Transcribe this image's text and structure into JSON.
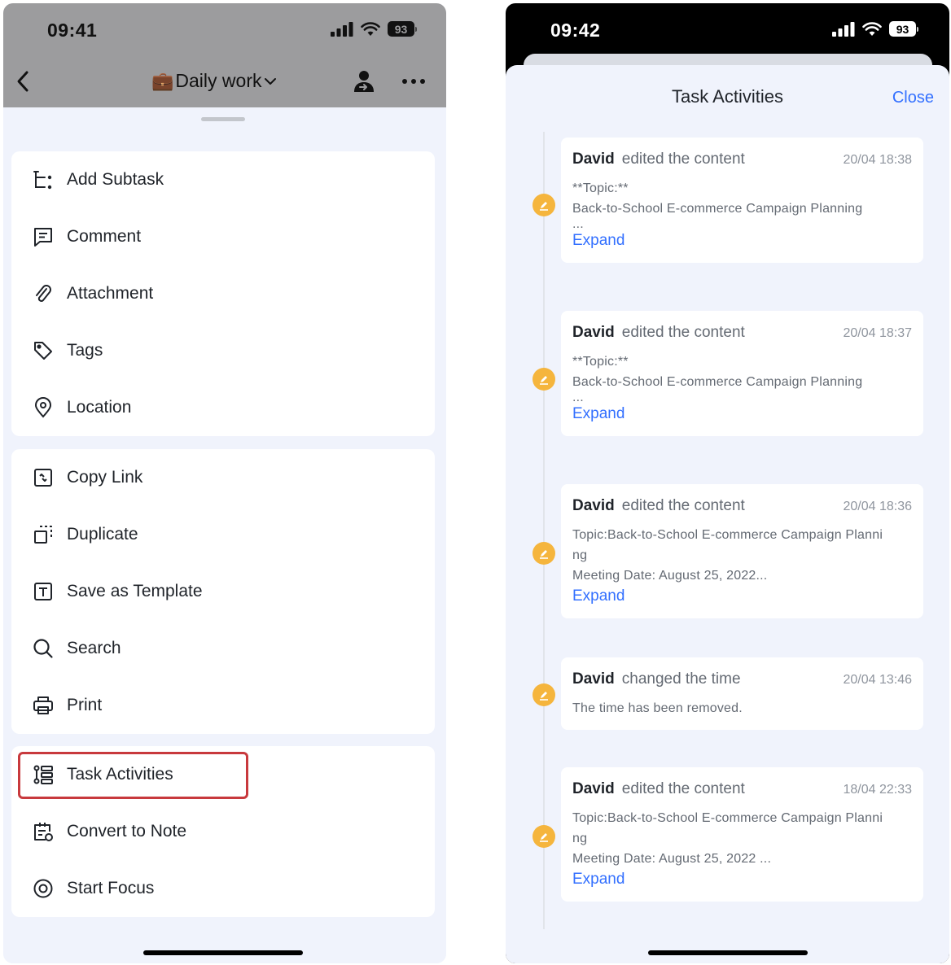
{
  "left_screen": {
    "status": {
      "time": "09:41",
      "battery": "93"
    },
    "nav": {
      "title": "Daily work",
      "title_emoji": "💼"
    },
    "menu_groups": [
      {
        "items": [
          {
            "label": "Add Subtask",
            "icon": "subtask-icon"
          },
          {
            "label": "Comment",
            "icon": "comment-icon"
          },
          {
            "label": "Attachment",
            "icon": "paperclip-icon"
          },
          {
            "label": "Tags",
            "icon": "tag-icon"
          },
          {
            "label": "Location",
            "icon": "location-pin-icon"
          }
        ]
      },
      {
        "items": [
          {
            "label": "Copy Link",
            "icon": "link-icon"
          },
          {
            "label": "Duplicate",
            "icon": "duplicate-icon"
          },
          {
            "label": "Save as Template",
            "icon": "template-icon"
          },
          {
            "label": "Search",
            "icon": "search-icon"
          },
          {
            "label": "Print",
            "icon": "printer-icon"
          }
        ]
      },
      {
        "items": [
          {
            "label": "Task Activities",
            "icon": "activity-list-icon",
            "highlighted": true
          },
          {
            "label": "Convert to Note",
            "icon": "note-icon"
          },
          {
            "label": "Start Focus",
            "icon": "focus-target-icon"
          }
        ]
      }
    ],
    "highlight_color": "#c8393d"
  },
  "right_screen": {
    "status": {
      "time": "09:42",
      "battery": "93"
    },
    "sheet": {
      "title": "Task Activities",
      "close_label": "Close"
    },
    "accent_color": "#3370ff",
    "dot_color": "#f5b53d",
    "activities": [
      {
        "user": "David",
        "action": "edited the content",
        "time": "20/04 18:38",
        "lines": [
          "**Topic:**",
          "Back-to-School E-commerce Campaign Planning",
          "..."
        ],
        "expand": "Expand"
      },
      {
        "user": "David",
        "action": "edited the content",
        "time": "20/04 18:37",
        "lines": [
          "**Topic:**",
          "Back-to-School E-commerce Campaign Planning",
          "..."
        ],
        "expand": "Expand"
      },
      {
        "user": "David",
        "action": "edited the content",
        "time": "20/04 18:36",
        "lines": [
          "Topic:Back-to-School E-commerce Campaign Planni",
          "ng",
          "Meeting Date: August 25, 2022..."
        ],
        "expand": "Expand"
      },
      {
        "user": "David",
        "action": "changed the time",
        "time": "20/04 13:46",
        "lines": [
          "The time has been removed."
        ],
        "expand": ""
      },
      {
        "user": "David",
        "action": "edited the content",
        "time": "18/04 22:33",
        "lines": [
          "Topic:Back-to-School E-commerce Campaign Planni",
          "ng",
          "Meeting Date: August 25, 2022 ..."
        ],
        "expand": "Expand"
      }
    ]
  }
}
